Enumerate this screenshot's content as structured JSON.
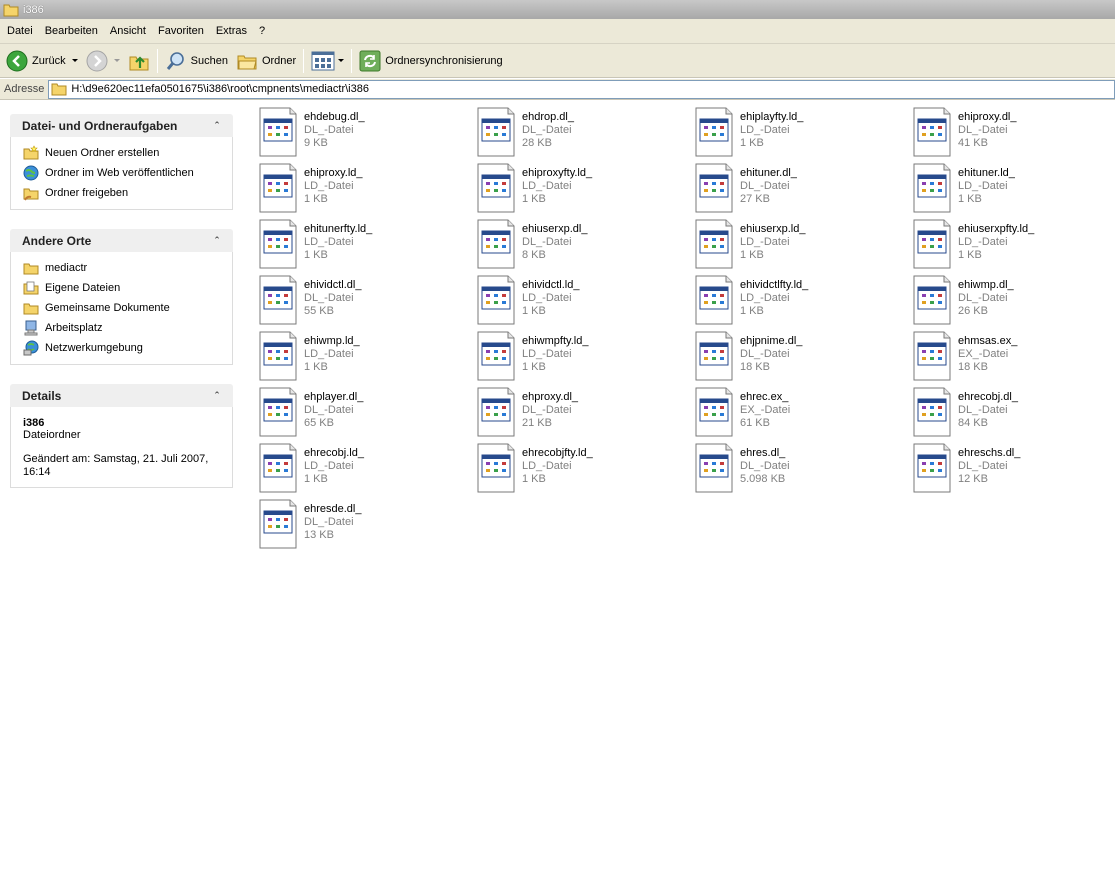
{
  "window": {
    "title": "i386"
  },
  "menu": [
    "Datei",
    "Bearbeiten",
    "Ansicht",
    "Favoriten",
    "Extras",
    "?"
  ],
  "toolbar": {
    "back_label": "Zurück",
    "search_label": "Suchen",
    "folders_label": "Ordner",
    "sync_label": "Ordnersynchronisierung"
  },
  "address": {
    "label": "Adresse",
    "path": "H:\\d9e620ec11efa0501675\\i386\\root\\cmpnents\\mediactr\\i386"
  },
  "tasks_panel": {
    "title": "Datei- und Ordneraufgaben",
    "items": [
      "Neuen Ordner erstellen",
      "Ordner im Web veröffentlichen",
      "Ordner freigeben"
    ]
  },
  "places_panel": {
    "title": "Andere Orte",
    "items": [
      "mediactr",
      "Eigene Dateien",
      "Gemeinsame Dokumente",
      "Arbeitsplatz",
      "Netzwerkumgebung"
    ]
  },
  "details_panel": {
    "title": "Details",
    "name": "i386",
    "kind": "Dateiordner",
    "modified_line1": "Geändert am: Samstag, 21. Juli 2007,",
    "modified_line2": "16:14"
  },
  "files": [
    {
      "name": "ehdebug.dl_",
      "type": "DL_-Datei",
      "size": "9 KB"
    },
    {
      "name": "ehdrop.dl_",
      "type": "DL_-Datei",
      "size": "28 KB"
    },
    {
      "name": "ehiplayfty.ld_",
      "type": "LD_-Datei",
      "size": "1 KB"
    },
    {
      "name": "ehiproxy.dl_",
      "type": "DL_-Datei",
      "size": "41 KB"
    },
    {
      "name": "ehiproxy.ld_",
      "type": "LD_-Datei",
      "size": "1 KB"
    },
    {
      "name": "ehiproxyfty.ld_",
      "type": "LD_-Datei",
      "size": "1 KB"
    },
    {
      "name": "ehituner.dl_",
      "type": "DL_-Datei",
      "size": "27 KB"
    },
    {
      "name": "ehituner.ld_",
      "type": "LD_-Datei",
      "size": "1 KB"
    },
    {
      "name": "ehitunerfty.ld_",
      "type": "LD_-Datei",
      "size": "1 KB"
    },
    {
      "name": "ehiuserxp.dl_",
      "type": "DL_-Datei",
      "size": "8 KB"
    },
    {
      "name": "ehiuserxp.ld_",
      "type": "LD_-Datei",
      "size": "1 KB"
    },
    {
      "name": "ehiuserxpfty.ld_",
      "type": "LD_-Datei",
      "size": "1 KB"
    },
    {
      "name": "ehividctl.dl_",
      "type": "DL_-Datei",
      "size": "55 KB"
    },
    {
      "name": "ehividctl.ld_",
      "type": "LD_-Datei",
      "size": "1 KB"
    },
    {
      "name": "ehividctlfty.ld_",
      "type": "LD_-Datei",
      "size": "1 KB"
    },
    {
      "name": "ehiwmp.dl_",
      "type": "DL_-Datei",
      "size": "26 KB"
    },
    {
      "name": "ehiwmp.ld_",
      "type": "LD_-Datei",
      "size": "1 KB"
    },
    {
      "name": "ehiwmpfty.ld_",
      "type": "LD_-Datei",
      "size": "1 KB"
    },
    {
      "name": "ehjpnime.dl_",
      "type": "DL_-Datei",
      "size": "18 KB"
    },
    {
      "name": "ehmsas.ex_",
      "type": "EX_-Datei",
      "size": "18 KB"
    },
    {
      "name": "ehplayer.dl_",
      "type": "DL_-Datei",
      "size": "65 KB"
    },
    {
      "name": "ehproxy.dl_",
      "type": "DL_-Datei",
      "size": "21 KB"
    },
    {
      "name": "ehrec.ex_",
      "type": "EX_-Datei",
      "size": "61 KB"
    },
    {
      "name": "ehrecobj.dl_",
      "type": "DL_-Datei",
      "size": "84 KB"
    },
    {
      "name": "ehrecobj.ld_",
      "type": "LD_-Datei",
      "size": "1 KB"
    },
    {
      "name": "ehrecobjfty.ld_",
      "type": "LD_-Datei",
      "size": "1 KB"
    },
    {
      "name": "ehres.dl_",
      "type": "DL_-Datei",
      "size": "5.098 KB"
    },
    {
      "name": "ehreschs.dl_",
      "type": "DL_-Datei",
      "size": "12 KB"
    },
    {
      "name": "ehresde.dl_",
      "type": "DL_-Datei",
      "size": "13 KB"
    }
  ]
}
